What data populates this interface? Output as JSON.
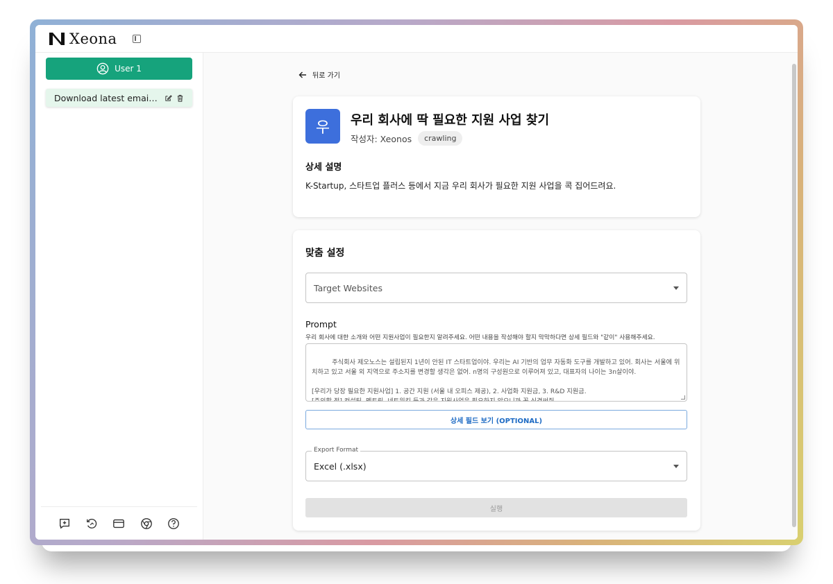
{
  "app": {
    "name": "Xeona"
  },
  "sidebar": {
    "user_label": "User 1",
    "tasks": [
      {
        "label": "Download latest email a..."
      }
    ],
    "footer_icons": [
      "new-chat-icon",
      "history-icon",
      "billing-icon",
      "chrome-icon",
      "help-icon"
    ]
  },
  "main": {
    "back_label": "뒤로 가기",
    "app_card": {
      "icon_char": "우",
      "title": "우리 회사에 딱 필요한 지원 사업 찾기",
      "author": "작성자: Xeonos",
      "tag": "crawling",
      "detail_heading": "상세 설명",
      "detail_text": "K-Startup, 스타트업 플러스 등에서 지금 우리 회사가 필요한 지원 사업을 콕 집어드려요."
    },
    "settings_card": {
      "heading": "맞춤 설정",
      "target_placeholder": "Target Websites",
      "prompt_label": "Prompt",
      "prompt_help": "우리 회사에 대한 소개와 어떤 지원사업이 필요한지 알려주세요. 어떤 내용을 작성해야 할지 막막하다면 상세 필드와 \"같이\" 사용해주세요.",
      "prompt_text": "주식회사 제오노스는 설립된지 1년이 안된 IT 스타트업이야. 우리는 AI 기반의 업무 자동화 도구를 개발하고 있어. 회사는 서울에 위치하고 있고 서울 외 지역으로 주소지를 변경할 생각은 없어. n명의 구성원으로 이루어져 있고, 대표자의 나이는 3n살이야.\n\n[우리가 당장 필요한 지원사업] 1. 공간 지원 (서울 내 오피스 제공), 2. 사업화 지원금, 3. R&D 지원금.\n[주의할 점] 컨설팅, 멘토링, 네트워킹 등과 같은 지원사업은 필요하지 않으니까 꼭 신경써줘.",
      "detail_fields_button": "상세 필드 보기 (OPTIONAL)",
      "export_label": "Export Format",
      "export_value": "Excel (.xlsx)",
      "run_button": "실행"
    }
  },
  "colors": {
    "accent_green": "#16a37c",
    "app_icon_blue": "#3d6fdc",
    "link_blue": "#1e6bc4"
  }
}
